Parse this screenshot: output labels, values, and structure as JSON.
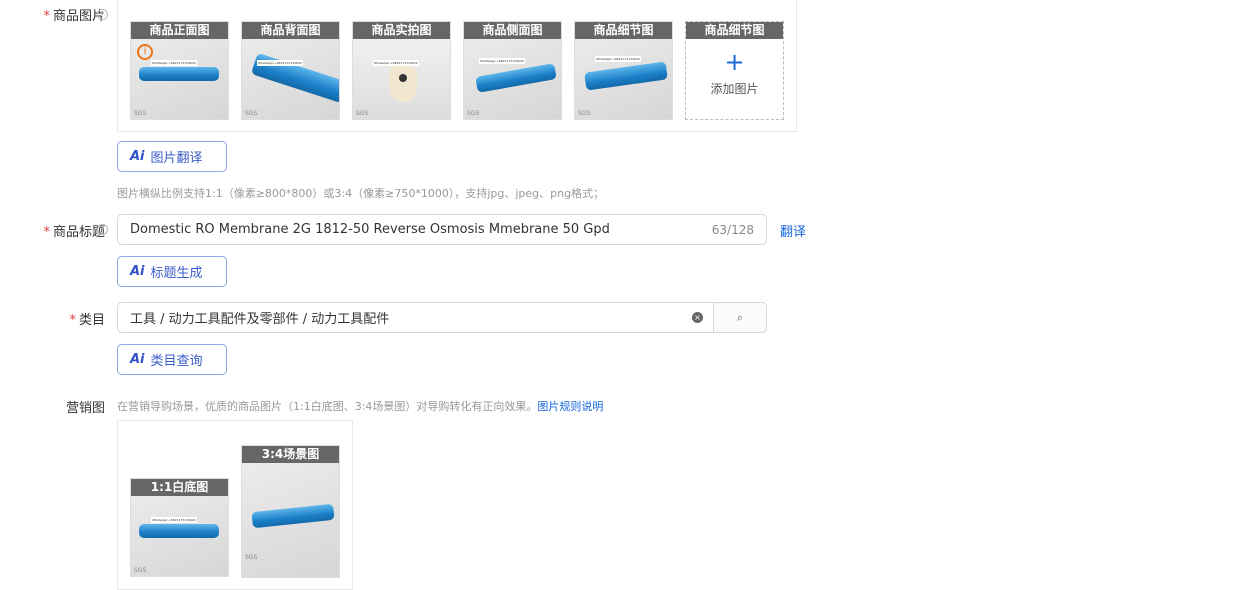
{
  "images_field": {
    "label": "商品图片",
    "required": true,
    "thumbs": [
      {
        "caption": "商品正面图"
      },
      {
        "caption": "商品背面图"
      },
      {
        "caption": "商品实拍图"
      },
      {
        "caption": "商品侧面图"
      },
      {
        "caption": "商品细节图"
      }
    ],
    "add_slot": {
      "caption": "商品细节图",
      "label": "添加图片"
    },
    "tag_text": "WhatsApp:+8615173134620",
    "watermark": "SGS",
    "ai_button": "图片翻译",
    "hint": "图片横纵比例支持1:1（像素≥800*800）或3:4（像素≥750*1000），支持jpg、jpeg、png格式；"
  },
  "title_field": {
    "label": "商品标题",
    "required": true,
    "value": "Domestic RO Membrane 2G 1812-50 Reverse Osmosis Mmebrane 50 Gpd",
    "count": "63/128",
    "translate": "翻译",
    "ai_button": "标题生成"
  },
  "category_field": {
    "label": "类目",
    "required": true,
    "value": "工具 / 动力工具配件及零部件 / 动力工具配件",
    "ai_button": "类目查询"
  },
  "marketing_field": {
    "label": "营销图",
    "hint": "在营销导购场景，优质的商品图片（1:1白底图、3:4场景图）对导购转化有正向效果。",
    "link": "图片规则说明",
    "images": [
      {
        "caption": "1:1白底图"
      },
      {
        "caption": "3:4场景图"
      }
    ]
  },
  "ai_icon": "Ai"
}
